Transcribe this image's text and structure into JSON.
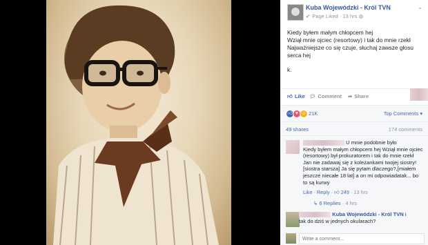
{
  "post": {
    "page_name": "Kuba Wojewódzki - Król TVN",
    "page_liked": "Page Liked",
    "separator": "·",
    "time": "13 hrs",
    "globe_icon": "globe-icon",
    "text_lines": [
      "Kiedy byłem małym chłopcem hej",
      "Wziął mnie ojciec (resortowy) i tak do mnie rzekł",
      "Najważniejsze co się czuje, słuchaj zawsze głosu serca hej",
      "k."
    ]
  },
  "actions": {
    "like": "Like",
    "comment": "Comment",
    "share": "Share"
  },
  "reactions": {
    "count": "21K",
    "top_comments": "Top Comments ▾"
  },
  "stats": {
    "shares": "49 shares",
    "comments": "174 comments"
  },
  "comments": [
    {
      "text_after_name": "U mnie podobnie było",
      "body": "Kiedy byłem małym chłopcem hej Wziął mnie ojciec (resortowy) był prokuratorem i tak do mnie rzekł Jan nie zadawaj się z koleżankami twojej siostry![siostra starsza] Ja się pytam dlaczego?,[miałem jeszcze niecałe 18 lat] a on mi odpowiadatak... bo to są kurwy",
      "like": "Like",
      "reply": "Reply",
      "likes_count": "249",
      "time": "13 hrs",
      "separator": "·"
    }
  ],
  "replies": {
    "label": "6 Replies",
    "time": "4 hrs",
    "separator": "·"
  },
  "reply": {
    "author": "Kuba Wojewódzki - Król TVN",
    "text_suffix": "i",
    "body": "tak do dziś w jednych okularach?"
  },
  "composer": {
    "placeholder": "Write a comment..."
  },
  "colors": {
    "link": "#365899",
    "accent": "#4267b2",
    "muted": "#90949c",
    "love": "#f25268",
    "haha": "#f7b125"
  }
}
